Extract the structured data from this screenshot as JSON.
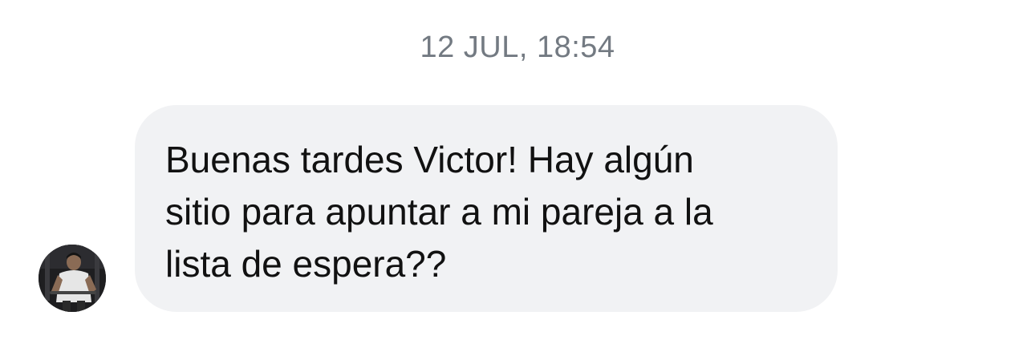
{
  "conversation": {
    "timestamp": "12 JUL, 18:54",
    "messages": [
      {
        "sender_avatar": "user-avatar",
        "text": "Buenas tardes Victor! Hay algún\nsitio para apuntar a mi pareja a la\nlista de espera??"
      }
    ]
  },
  "colors": {
    "background": "#ffffff",
    "bubble": "#f1f2f4",
    "timestamp": "#737a82",
    "text": "#111111"
  }
}
